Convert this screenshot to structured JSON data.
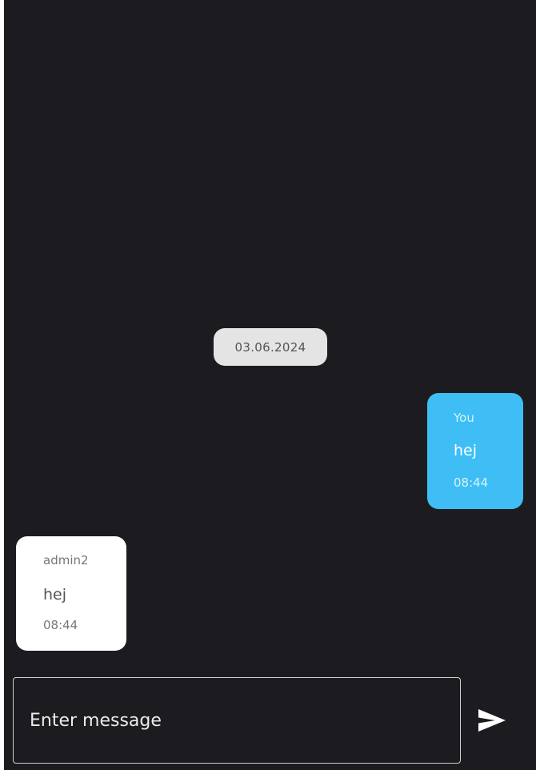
{
  "chat": {
    "date_separator": "03.06.2024",
    "messages": [
      {
        "direction": "outgoing",
        "sender": "You",
        "text": "hej",
        "time": "08:44"
      },
      {
        "direction": "incoming",
        "sender": "admin2",
        "text": "hej",
        "time": "08:44"
      }
    ]
  },
  "composer": {
    "placeholder": "Enter message",
    "value": "",
    "send_icon": "send-icon"
  },
  "colors": {
    "background": "#1c1b1f",
    "outgoing_bubble": "#3ebef5",
    "incoming_bubble": "#ffffff",
    "date_chip": "#e4e4e4"
  }
}
